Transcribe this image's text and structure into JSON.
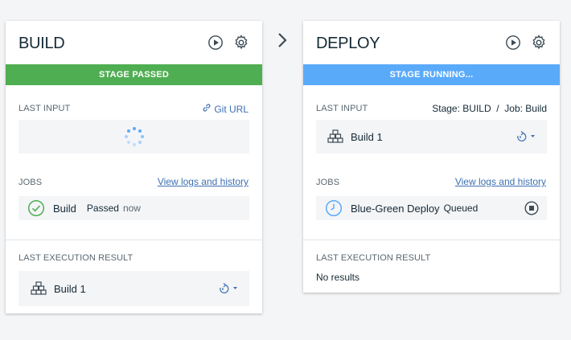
{
  "build": {
    "title": "BUILD",
    "status": "STAGE PASSED",
    "status_color": "#5aa700",
    "last_input_label": "LAST INPUT",
    "git_link": "Git URL",
    "jobs_label": "JOBS",
    "jobs_link": "View logs and history",
    "job_name": "Build",
    "job_status": "Passed",
    "job_time": "now",
    "last_exec_label": "LAST EXECUTION RESULT",
    "result_name": "Build 1"
  },
  "deploy": {
    "title": "DEPLOY",
    "status": "STAGE RUNNING...",
    "status_color": "#5aaafa",
    "last_input_label": "LAST INPUT",
    "input_source": "Stage: BUILD  /  Job: Build",
    "input_name": "Build 1",
    "jobs_label": "JOBS",
    "jobs_link": "View logs and history",
    "job_name": "Blue-Green Deploy",
    "job_status": "Queued",
    "last_exec_label": "LAST EXECUTION RESULT",
    "no_results": "No results"
  },
  "colors": {
    "passed_green": "#4fae52",
    "running_blue": "#5aaafa",
    "link_blue": "#3d70b2"
  }
}
